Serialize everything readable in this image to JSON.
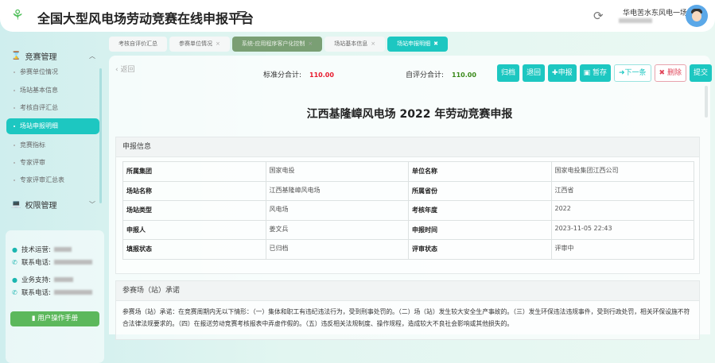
{
  "header": {
    "title": "全国大型风电场劳动竞赛在线申报平台",
    "user_name": "华电苦水东风电一场"
  },
  "sidebar": {
    "groups": [
      {
        "label": "竞赛管理"
      },
      {
        "label": "权限管理"
      }
    ],
    "items": [
      {
        "label": "参赛单位情况"
      },
      {
        "label": "场站基本信息"
      },
      {
        "label": "考核自评汇总"
      },
      {
        "label": "场站申报明细"
      },
      {
        "label": "竞赛指标"
      },
      {
        "label": "专家评审"
      },
      {
        "label": "专家评审汇总表"
      }
    ],
    "contact": {
      "tech_label": "技术运营:",
      "phone_label": "联系电话:",
      "biz_label": "业务支持:",
      "phone_label2": "联系电话:",
      "manual_button": "用户操作手册"
    }
  },
  "tabs": [
    {
      "label": "考核自评价汇总"
    },
    {
      "label": "参赛单位情况"
    },
    {
      "label": "系统-应用程序客户化控制"
    },
    {
      "label": "场站基本信息"
    },
    {
      "label": "场站申报明细"
    }
  ],
  "toolbar": {
    "back": "返回",
    "standard_label": "标准分合计:",
    "standard_value": "110.00",
    "self_label": "自评分合计:",
    "self_value": "110.00",
    "buttons": {
      "archive": "归档",
      "return": "退回",
      "declare": "申报",
      "save": "暂存",
      "next": "下一条",
      "delete": "删除",
      "submit": "提交"
    }
  },
  "document": {
    "title": "江西基隆嶂风电场 2022 年劳动竞赛申报",
    "info_section": "申报信息",
    "rows": [
      [
        "所属集团",
        "国家电投",
        "单位名称",
        "国家电投集团江西公司"
      ],
      [
        "场站名称",
        "江西基隆嶂风电场",
        "所属省份",
        "江西省"
      ],
      [
        "场站类型",
        "风电场",
        "考核年度",
        "2022"
      ],
      [
        "申报人",
        "姜文兵",
        "申报时间",
        "2023-11-05 22:43"
      ],
      [
        "填报状态",
        "已归档",
        "评审状态",
        "评审中"
      ]
    ],
    "pledge_section": "参赛场（站）承诺",
    "pledge_text": "参赛场（站）承诺：在竞赛周期内无以下情形：（一）集体和职工有违纪违法行为，受到刑事处罚的。（二）场（站）发生较大安全生产事故的。（三）发生环保违法违规事件，受到行政处罚，相关环保设施不符合法律法规要求的。（四）在报送劳动竞赛考核报表中弄虚作假的。（五）违反相关法规制度、操作规程，造成较大不良社会影响或其他损失的。"
  },
  "colors": {
    "accent": "#1dc7c1",
    "red": "#e8192c",
    "green": "#3a8a1a",
    "manual": "#5cb85c"
  }
}
